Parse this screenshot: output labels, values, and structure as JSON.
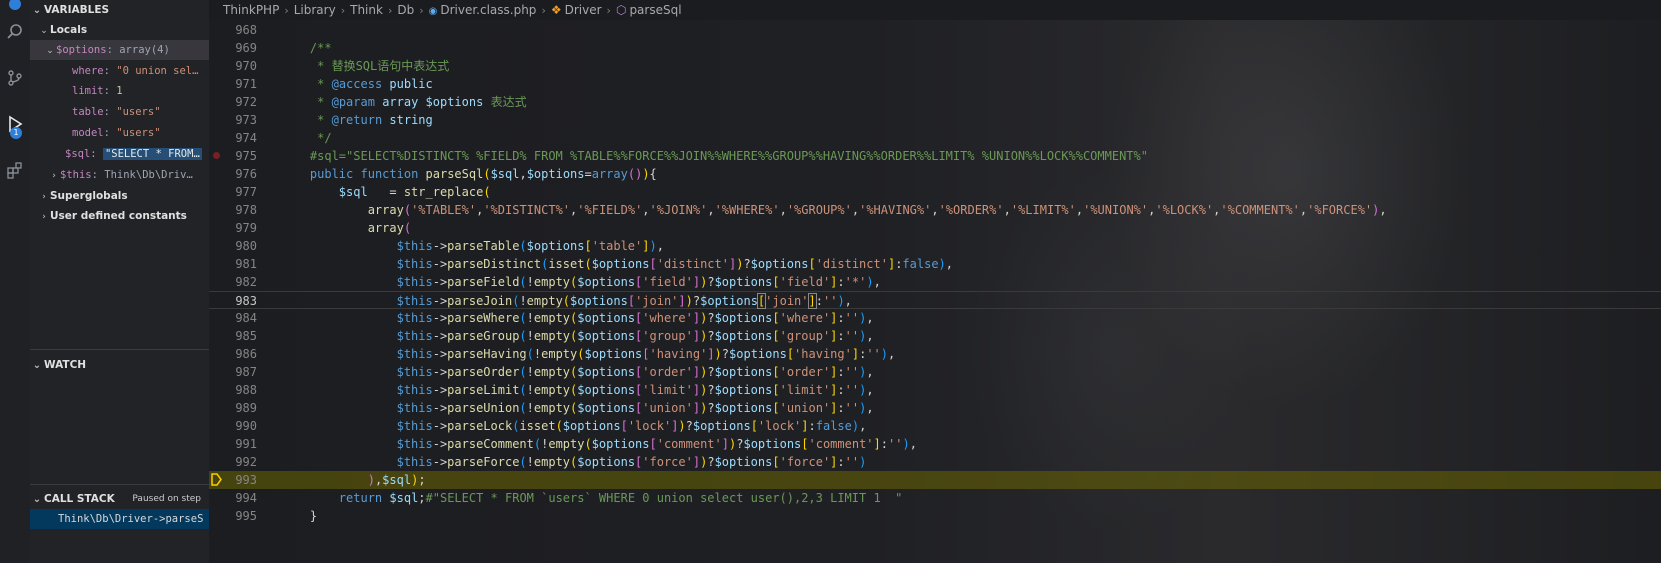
{
  "activity_bar": {
    "items": [
      "explorer-icon",
      "search-icon",
      "source-control-icon",
      "run-debug-icon",
      "extensions-icon"
    ],
    "debug_badge": "1"
  },
  "sidebar": {
    "variables_title": "VARIABLES",
    "locals_label": "Locals",
    "options_name": "$options",
    "options_value": "array(4)",
    "options_children": [
      {
        "key": "where",
        "value": "\"0 union sel…"
      },
      {
        "key": "limit",
        "value": "1"
      },
      {
        "key": "table",
        "value": "\"users\""
      },
      {
        "key": "model",
        "value": "\"users\""
      }
    ],
    "sql_name": "$sql",
    "sql_value": "\"SELECT * FROM…",
    "this_name": "$this",
    "this_value": "Think\\Db\\Driv…",
    "superglobals_label": "Superglobals",
    "constants_label": "User defined constants",
    "watch_title": "WATCH",
    "callstack_title": "CALL STACK",
    "callstack_status": "Paused on step",
    "callstack_frame": "Think\\Db\\Driver->parseS"
  },
  "breadcrumb": {
    "items": [
      "ThinkPHP",
      "Library",
      "Think",
      "Db",
      "Driver.class.php",
      "Driver",
      "parseSql"
    ]
  },
  "editor": {
    "lines": [
      {
        "n": "968",
        "html": ""
      },
      {
        "n": "969",
        "html": "    <span class='c-com'>/**</span>"
      },
      {
        "n": "970",
        "html": "    <span class='c-com'> * 替换SQL语句中表达式</span>"
      },
      {
        "n": "971",
        "html": "    <span class='c-com'> * </span><span class='c-kw'>@access</span><span class='c-com'> </span><span class='c-var'>public</span>"
      },
      {
        "n": "972",
        "html": "    <span class='c-com'> * </span><span class='c-kw'>@param</span><span class='c-com'> </span><span class='c-var'>array $options</span><span class='c-com'> 表达式</span>"
      },
      {
        "n": "973",
        "html": "    <span class='c-com'> * </span><span class='c-kw'>@return</span><span class='c-com'> </span><span class='c-var'>string</span>"
      },
      {
        "n": "974",
        "html": "    <span class='c-com'> */</span>"
      },
      {
        "n": "975",
        "html": "    <span class='c-com'>#sql=\"SELECT%DISTINCT% %FIELD% FROM %TABLE%%FORCE%%JOIN%%WHERE%%GROUP%%HAVING%%ORDER%%LIMIT% %UNION%%LOCK%%COMMENT%\"</span>"
      },
      {
        "n": "976",
        "html": "    <span class='c-kw'>public</span> <span class='c-kw'>function</span> <span class='c-fn'>parseSql</span><span class='c-p1'>(</span><span class='c-var'>$sql</span>,<span class='c-var'>$options</span>=<span class='c-kw'>array</span><span class='c-p2'>()</span><span class='c-p1'>)</span>{"
      },
      {
        "n": "977",
        "html": "        <span class='c-var'>$sql</span>   = <span class='c-fn'>str_replace</span><span class='c-p1'>(</span>"
      },
      {
        "n": "978",
        "html": "            <span class='c-fn'>array</span><span class='c-p2'>(</span><span class='c-str'>'%TABLE%'</span>,<span class='c-str'>'%DISTINCT%'</span>,<span class='c-str'>'%FIELD%'</span>,<span class='c-str'>'%JOIN%'</span>,<span class='c-str'>'%WHERE%'</span>,<span class='c-str'>'%GROUP%'</span>,<span class='c-str'>'%HAVING%'</span>,<span class='c-str'>'%ORDER%'</span>,<span class='c-str'>'%LIMIT%'</span>,<span class='c-str'>'%UNION%'</span>,<span class='c-str'>'%LOCK%'</span>,<span class='c-str'>'%COMMENT%'</span>,<span class='c-str'>'%FORCE%'</span><span class='c-p2'>)</span>,"
      },
      {
        "n": "979",
        "html": "            <span class='c-fn'>array</span><span class='c-p2'>(</span>"
      },
      {
        "n": "980",
        "html": "                <span class='c-this'>$this</span>-><span class='c-fn'>parseTable</span><span class='c-p3'>(</span><span class='c-var'>$options</span><span class='c-p1'>[</span><span class='c-str'>'table'</span><span class='c-p1'>]</span><span class='c-p3'>)</span>,"
      },
      {
        "n": "981",
        "html": "                <span class='c-this'>$this</span>-><span class='c-fn'>parseDistinct</span><span class='c-p3'>(</span><span class='c-fn'>isset</span><span class='c-p1'>(</span><span class='c-var'>$options</span><span class='c-p2'>[</span><span class='c-str'>'distinct'</span><span class='c-p2'>]</span><span class='c-p1'>)</span>?<span class='c-var'>$options</span><span class='c-p1'>[</span><span class='c-str'>'distinct'</span><span class='c-p1'>]</span>:<span class='c-kw'>false</span><span class='c-p3'>)</span>,"
      },
      {
        "n": "982",
        "html": "                <span class='c-this'>$this</span>-><span class='c-fn'>parseField</span><span class='c-p3'>(</span>!<span class='c-fn'>empty</span><span class='c-p1'>(</span><span class='c-var'>$options</span><span class='c-p2'>[</span><span class='c-str'>'field'</span><span class='c-p2'>]</span><span class='c-p1'>)</span>?<span class='c-var'>$options</span><span class='c-p1'>[</span><span class='c-str'>'field'</span><span class='c-p1'>]</span>:<span class='c-str'>'*'</span><span class='c-p3'>)</span>,"
      },
      {
        "n": "983",
        "html": "                <span class='c-this'>$this</span>-><span class='c-fn'>parseJoin</span><span class='c-p3'>(</span>!<span class='c-fn'>empty</span><span class='c-p1'>(</span><span class='c-var'>$options</span><span class='c-p2'>[</span><span class='c-str'>'join'</span><span class='c-p2'>]</span><span class='c-p1'>)</span>?<span class='c-var'>$options</span><span class='c-p1 c-boxed'>[</span><span class='c-str'>'join'</span><span class='c-p1 c-boxed'>]</span>:<span class='c-str'>''</span><span class='c-p3'>)</span>,"
      },
      {
        "n": "984",
        "html": "                <span class='c-this'>$this</span>-><span class='c-fn'>parseWhere</span><span class='c-p3'>(</span>!<span class='c-fn'>empty</span><span class='c-p1'>(</span><span class='c-var'>$options</span><span class='c-p2'>[</span><span class='c-str'>'where'</span><span class='c-p2'>]</span><span class='c-p1'>)</span>?<span class='c-var'>$options</span><span class='c-p1'>[</span><span class='c-str'>'where'</span><span class='c-p1'>]</span>:<span class='c-str'>''</span><span class='c-p3'>)</span>,"
      },
      {
        "n": "985",
        "html": "                <span class='c-this'>$this</span>-><span class='c-fn'>parseGroup</span><span class='c-p3'>(</span>!<span class='c-fn'>empty</span><span class='c-p1'>(</span><span class='c-var'>$options</span><span class='c-p2'>[</span><span class='c-str'>'group'</span><span class='c-p2'>]</span><span class='c-p1'>)</span>?<span class='c-var'>$options</span><span class='c-p1'>[</span><span class='c-str'>'group'</span><span class='c-p1'>]</span>:<span class='c-str'>''</span><span class='c-p3'>)</span>,"
      },
      {
        "n": "986",
        "html": "                <span class='c-this'>$this</span>-><span class='c-fn'>parseHaving</span><span class='c-p3'>(</span>!<span class='c-fn'>empty</span><span class='c-p1'>(</span><span class='c-var'>$options</span><span class='c-p2'>[</span><span class='c-str'>'having'</span><span class='c-p2'>]</span><span class='c-p1'>)</span>?<span class='c-var'>$options</span><span class='c-p1'>[</span><span class='c-str'>'having'</span><span class='c-p1'>]</span>:<span class='c-str'>''</span><span class='c-p3'>)</span>,"
      },
      {
        "n": "987",
        "html": "                <span class='c-this'>$this</span>-><span class='c-fn'>parseOrder</span><span class='c-p3'>(</span>!<span class='c-fn'>empty</span><span class='c-p1'>(</span><span class='c-var'>$options</span><span class='c-p2'>[</span><span class='c-str'>'order'</span><span class='c-p2'>]</span><span class='c-p1'>)</span>?<span class='c-var'>$options</span><span class='c-p1'>[</span><span class='c-str'>'order'</span><span class='c-p1'>]</span>:<span class='c-str'>''</span><span class='c-p3'>)</span>,"
      },
      {
        "n": "988",
        "html": "                <span class='c-this'>$this</span>-><span class='c-fn'>parseLimit</span><span class='c-p3'>(</span>!<span class='c-fn'>empty</span><span class='c-p1'>(</span><span class='c-var'>$options</span><span class='c-p2'>[</span><span class='c-str'>'limit'</span><span class='c-p2'>]</span><span class='c-p1'>)</span>?<span class='c-var'>$options</span><span class='c-p1'>[</span><span class='c-str'>'limit'</span><span class='c-p1'>]</span>:<span class='c-str'>''</span><span class='c-p3'>)</span>,"
      },
      {
        "n": "989",
        "html": "                <span class='c-this'>$this</span>-><span class='c-fn'>parseUnion</span><span class='c-p3'>(</span>!<span class='c-fn'>empty</span><span class='c-p1'>(</span><span class='c-var'>$options</span><span class='c-p2'>[</span><span class='c-str'>'union'</span><span class='c-p2'>]</span><span class='c-p1'>)</span>?<span class='c-var'>$options</span><span class='c-p1'>[</span><span class='c-str'>'union'</span><span class='c-p1'>]</span>:<span class='c-str'>''</span><span class='c-p3'>)</span>,"
      },
      {
        "n": "990",
        "html": "                <span class='c-this'>$this</span>-><span class='c-fn'>parseLock</span><span class='c-p3'>(</span><span class='c-fn'>isset</span><span class='c-p1'>(</span><span class='c-var'>$options</span><span class='c-p2'>[</span><span class='c-str'>'lock'</span><span class='c-p2'>]</span><span class='c-p1'>)</span>?<span class='c-var'>$options</span><span class='c-p1'>[</span><span class='c-str'>'lock'</span><span class='c-p1'>]</span>:<span class='c-kw'>false</span><span class='c-p3'>)</span>,"
      },
      {
        "n": "991",
        "html": "                <span class='c-this'>$this</span>-><span class='c-fn'>parseComment</span><span class='c-p3'>(</span>!<span class='c-fn'>empty</span><span class='c-p1'>(</span><span class='c-var'>$options</span><span class='c-p2'>[</span><span class='c-str'>'comment'</span><span class='c-p2'>]</span><span class='c-p1'>)</span>?<span class='c-var'>$options</span><span class='c-p1'>[</span><span class='c-str'>'comment'</span><span class='c-p1'>]</span>:<span class='c-str'>''</span><span class='c-p3'>)</span>,"
      },
      {
        "n": "992",
        "html": "                <span class='c-this'>$this</span>-><span class='c-fn'>parseForce</span><span class='c-p3'>(</span>!<span class='c-fn'>empty</span><span class='c-p1'>(</span><span class='c-var'>$options</span><span class='c-p2'>[</span><span class='c-str'>'force'</span><span class='c-p2'>]</span><span class='c-p1'>)</span>?<span class='c-var'>$options</span><span class='c-p1'>[</span><span class='c-str'>'force'</span><span class='c-p1'>]</span>:<span class='c-str'>''</span><span class='c-p3'>)</span>"
      },
      {
        "n": "993",
        "html": "            <span class='c-p2'>)</span>,<span class='c-var'>$sql</span><span class='c-p1'>)</span>;"
      },
      {
        "n": "994",
        "html": "        <span class='c-kw'>return</span> <span class='c-var'>$sql</span>;<span class='c-com'>#\"SELECT * FROM `users` WHERE 0 union select user(),2,3 LIMIT 1  \"</span>"
      },
      {
        "n": "995",
        "html": "    }"
      }
    ]
  }
}
